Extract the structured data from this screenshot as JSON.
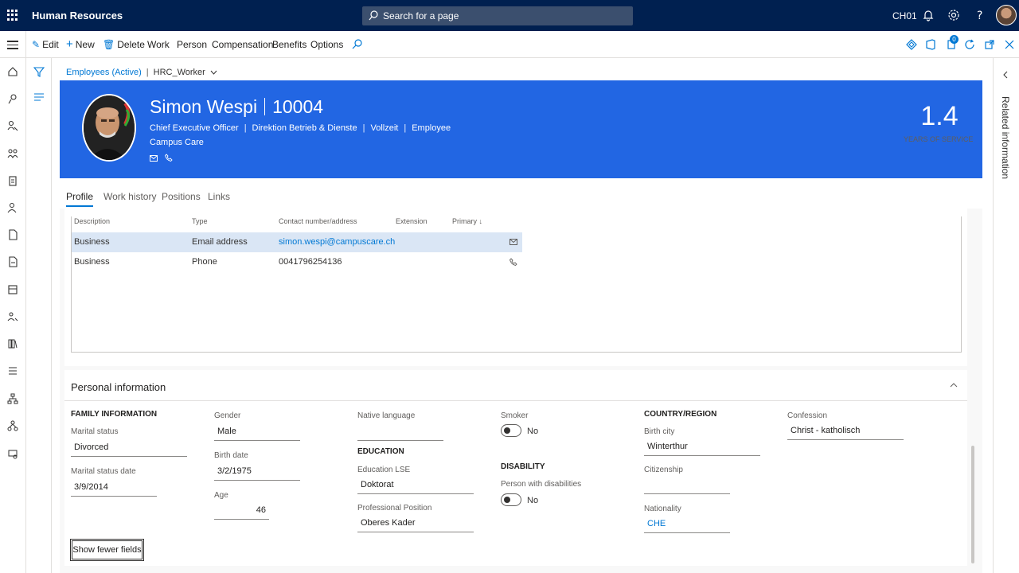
{
  "app": {
    "title": "Human Resources",
    "search_placeholder": "Search for a page",
    "company": "CH01"
  },
  "actions": {
    "edit": "Edit",
    "new": "New",
    "delete": "Delete",
    "work": "Work",
    "person": "Person",
    "compensation": "Compensation",
    "benefits": "Benefits",
    "options": "Options",
    "notification_count": "0"
  },
  "breadcrumb": {
    "list": "Employees (Active)",
    "view": "HRC_Worker"
  },
  "employee": {
    "name": "Simon Wespi",
    "id": "10004",
    "title": "Chief Executive Officer",
    "department": "Direktion Betrieb & Dienste",
    "employment": "Vollzeit",
    "type": "Employee",
    "company": "Campus Care",
    "years_of_service": "1.4",
    "years_label": "YEARS OF SERVICE"
  },
  "tabs": [
    "Profile",
    "Work history",
    "Positions",
    "Links"
  ],
  "contact_grid": {
    "headers": [
      "Description",
      "Type",
      "Contact number/address",
      "Extension",
      "Primary"
    ],
    "rows": [
      {
        "description": "Business",
        "type": "Email address",
        "contact": "simon.wespi@campuscare.ch",
        "extension": "",
        "icon": "mail-icon"
      },
      {
        "description": "Business",
        "type": "Phone",
        "contact": "0041796254136",
        "extension": "",
        "icon": "phone-icon"
      }
    ]
  },
  "personal": {
    "title": "Personal information",
    "family_heading": "FAMILY INFORMATION",
    "marital_status_label": "Marital status",
    "marital_status": "Divorced",
    "marital_date_label": "Marital status date",
    "marital_date": "3/9/2014",
    "gender_label": "Gender",
    "gender": "Male",
    "birth_date_label": "Birth date",
    "birth_date": "3/2/1975",
    "age_label": "Age",
    "age": "46",
    "native_language_label": "Native language",
    "native_language": "",
    "education_heading": "EDUCATION",
    "education_lse_label": "Education LSE",
    "education_lse": "Doktorat",
    "prof_position_label": "Professional Position",
    "prof_position": "Oberes Kader",
    "smoker_label": "Smoker",
    "smoker": "No",
    "disability_heading": "DISABILITY",
    "disabilities_label": "Person with disabilities",
    "disabilities": "No",
    "country_heading": "COUNTRY/REGION",
    "birth_city_label": "Birth city",
    "birth_city": "Winterthur",
    "citizenship_label": "Citizenship",
    "citizenship": "",
    "nationality_label": "Nationality",
    "nationality": "CHE",
    "confession_label": "Confession",
    "confession": "Christ - katholisch",
    "show_fewer": "Show fewer fields"
  },
  "related": {
    "label": "Related information"
  },
  "colors": {
    "topbar": "#002050",
    "hero": "#2266e3",
    "accent": "#0078d4"
  }
}
